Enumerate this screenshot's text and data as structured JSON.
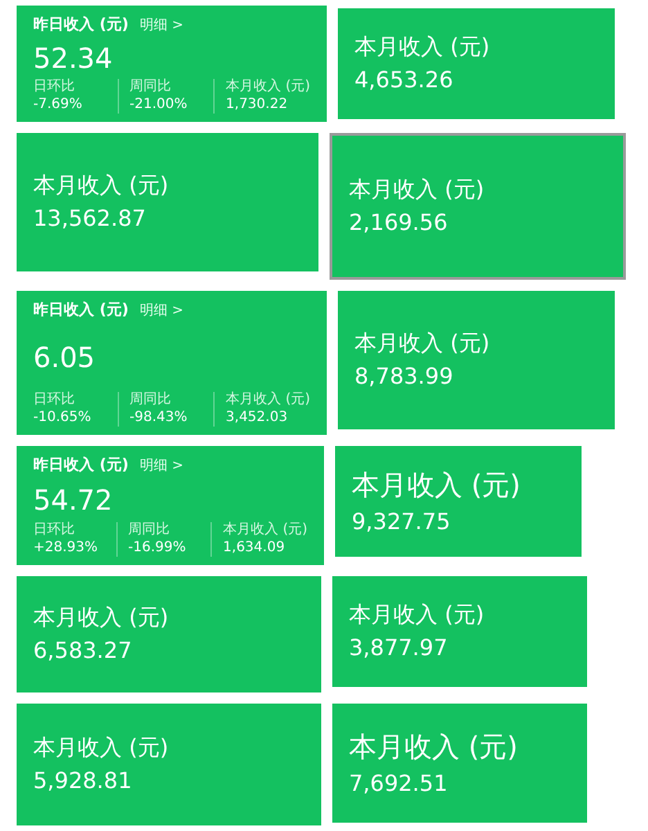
{
  "cards": [
    {
      "kind": "summary",
      "title": "昨日收入 (元)",
      "link": "明细 >",
      "value": "52.34",
      "stats": [
        {
          "label": "日环比",
          "value": "-7.69%"
        },
        {
          "label": "周同比",
          "value": "-21.00%"
        },
        {
          "label": "本月收入 (元)",
          "value": "1,730.22"
        }
      ]
    },
    {
      "kind": "month",
      "title": "本月收入 (元)",
      "value": "4,653.26"
    },
    {
      "kind": "month",
      "title": "本月收入 (元)",
      "value": "13,562.87"
    },
    {
      "kind": "month",
      "title": "本月收入 (元)",
      "value": "2,169.56"
    },
    {
      "kind": "summary",
      "title": "昨日收入 (元)",
      "link": "明细 >",
      "value": "6.05",
      "stats": [
        {
          "label": "日环比",
          "value": "-10.65%"
        },
        {
          "label": "周同比",
          "value": "-98.43%"
        },
        {
          "label": "本月收入 (元)",
          "value": "3,452.03"
        }
      ]
    },
    {
      "kind": "month",
      "title": "本月收入 (元)",
      "value": "8,783.99"
    },
    {
      "kind": "summary",
      "title": "昨日收入 (元)",
      "link": "明细 >",
      "value": "54.72",
      "stats": [
        {
          "label": "日环比",
          "value": "+28.93%"
        },
        {
          "label": "周同比",
          "value": "-16.99%"
        },
        {
          "label": "本月收入 (元)",
          "value": "1,634.09"
        }
      ]
    },
    {
      "kind": "month",
      "title": "本月收入 (元)",
      "value": "9,327.75"
    },
    {
      "kind": "month",
      "title": "本月收入 (元)",
      "value": "6,583.27"
    },
    {
      "kind": "month",
      "title": "本月收入 (元)",
      "value": "3,877.97"
    },
    {
      "kind": "month",
      "title": "本月收入 (元)",
      "value": "5,928.81"
    },
    {
      "kind": "month",
      "title": "本月收入 (元)",
      "value": "7,692.51"
    }
  ]
}
